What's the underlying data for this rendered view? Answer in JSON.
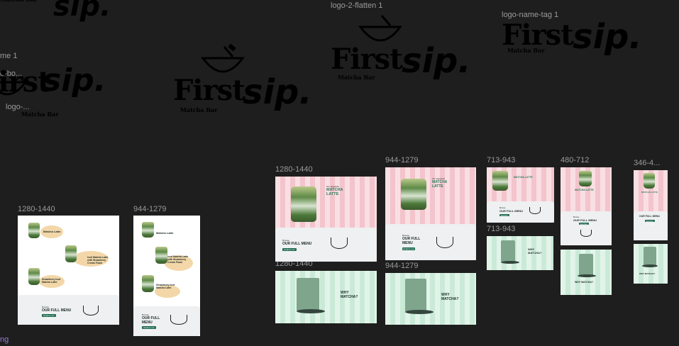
{
  "canvas": {
    "background": "#1e1e1e"
  },
  "layer_labels": {
    "logo_2_flatten": "logo-2-flatten 1",
    "logo_name_tag": "logo-name-tag 1",
    "me_1": "me 1",
    "o_bo": "o-bo...",
    "logo_trunc": "logo-...",
    "ng": "ng"
  },
  "logo": {
    "first": "First",
    "sip": "sip.",
    "tagline": "Matcha Bar"
  },
  "frame_labels": {
    "w_a_1280": "1280-1440",
    "w_a_944": "944-1279",
    "p_1280": "1280-1440",
    "p_944": "944-1279",
    "p_713": "713-943",
    "p_480": "480-712",
    "p_346": "346-4...",
    "m_1280": "1280-1440",
    "m_944": "944-1279",
    "m_713": "713-943"
  },
  "content": {
    "hero_kicker": "Our signature",
    "hero_title": "MATCHA LATTE",
    "menu_kicker": "Browse",
    "menu_title": "OUR FULL MENU",
    "menu_button": "Explore our menu",
    "why_title": "WHY MATCHA?",
    "drinks": [
      "Matcha Latte",
      "Iced Matcha Latte with Strawberry Cream Foam",
      "Strawberry Iced Matcha Latte"
    ]
  },
  "colors": {
    "accent_green": "#1f6b4e",
    "pink_stripe": "#f3c4cc",
    "mint_stripe": "#c9ead7",
    "cream_blob": "#f3d7a8"
  }
}
